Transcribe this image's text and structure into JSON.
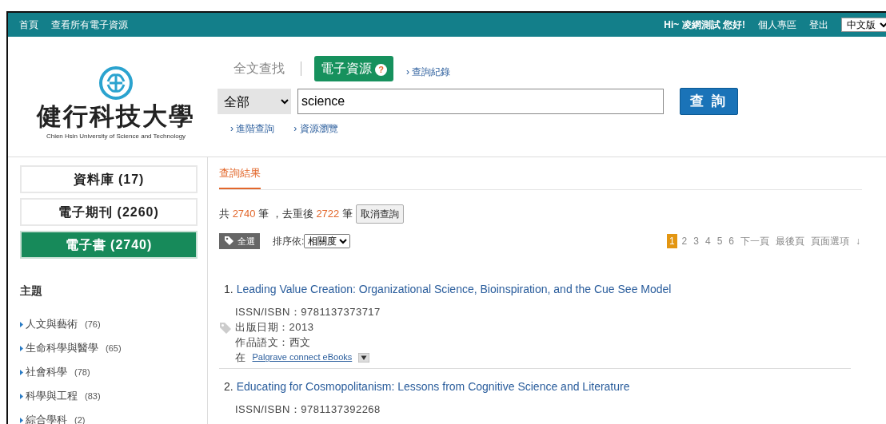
{
  "top_bar": {
    "left_links": [
      "首頁",
      "查看所有電子資源"
    ],
    "greeting": "Hi~ 凌網測試 您好!",
    "right_links": [
      "個人專區",
      "登出"
    ],
    "language": {
      "value": "中文版"
    }
  },
  "logo": {
    "name": "健行科技大學",
    "subtitle": "Chien Hsin University of Science and Technology"
  },
  "search_tabs": [
    {
      "label": "全文查找",
      "selected": false
    },
    {
      "label": "電子資源",
      "selected": true,
      "help": "?"
    }
  ],
  "history_link": {
    "marker": "›",
    "label": "查詢紀錄"
  },
  "search": {
    "scope": "全部",
    "query": "science",
    "button": "查 詢"
  },
  "search_links": [
    {
      "marker": "›",
      "label": "進階查詢"
    },
    {
      "marker": "›",
      "label": "資源瀏覽"
    }
  ],
  "categories": [
    {
      "label": "資料庫 (17)",
      "selected": false
    },
    {
      "label": "電子期刊 (2260)",
      "selected": false
    },
    {
      "label": "電子書 (2740)",
      "selected": true
    }
  ],
  "facet": {
    "title": "主題",
    "items": [
      {
        "label": "人文與藝術",
        "count": "(76)"
      },
      {
        "label": "生命科學與醫學",
        "count": "(65)"
      },
      {
        "label": "社會科學",
        "count": "(78)"
      },
      {
        "label": "科學與工程",
        "count": "(83)"
      },
      {
        "label": "綜合學科",
        "count": "(2)"
      }
    ]
  },
  "results_tab": "查詢結果",
  "summary": [
    {
      "text": "共 ",
      "highlight": false
    },
    {
      "text": "2740",
      "highlight": true
    },
    {
      "text": " 筆 ，去重後 ",
      "highlight": false
    },
    {
      "text": "2722",
      "highlight": true
    },
    {
      "text": " 筆",
      "highlight": false
    }
  ],
  "cancel_button": "取消查詢",
  "select_all": "全選",
  "sort": {
    "label": "排序依:",
    "value": "相關度"
  },
  "pagination": {
    "pages": [
      {
        "label": "1",
        "selected": true
      },
      {
        "label": "2",
        "selected": false
      },
      {
        "label": "3",
        "selected": false
      },
      {
        "label": "4",
        "selected": false
      },
      {
        "label": "5",
        "selected": false
      },
      {
        "label": "6",
        "selected": false
      }
    ],
    "links": [
      "下一頁",
      "最後頁",
      "頁面選項"
    ],
    "arrow": "↓"
  },
  "results": [
    {
      "number": "1.",
      "title": "Leading Value Creation: Organizational Science, Bioinspiration, and the Cue See Model",
      "fields": [
        "ISSN/ISBN：9781137373717",
        "出版日期：2013",
        "作品語文：西文"
      ],
      "source_prefix": "在",
      "source": "Palgrave connect eBooks"
    },
    {
      "number": "2.",
      "title": "Educating for Cosmopolitanism: Lessons from Cognitive Science and Literature",
      "fields": [
        "ISSN/ISBN：9781137392268"
      ]
    }
  ]
}
